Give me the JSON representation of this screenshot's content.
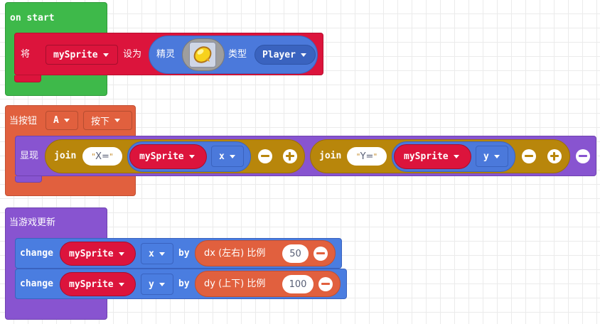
{
  "colors": {
    "loops_green": "#3eb94a",
    "sprites_red": "#dc143c",
    "controller_orange": "#e1603e",
    "game_purple": "#8854d0",
    "text_gold": "#b8860b",
    "math_blue": "#4a7de0",
    "sprite_blue": "#4b79db"
  },
  "on_start": {
    "hat_label": "on start",
    "set_label": "将",
    "variable": "mySprite",
    "to_label": "设为",
    "sprite_label": "精灵",
    "image_icon": "lemon-sprite-icon",
    "kind_label": "类型",
    "kind": "Player"
  },
  "button_event": {
    "label": "当按钮",
    "button": "A",
    "event": "按下",
    "show_label": "显现",
    "join1": {
      "label": "join",
      "text": "X=",
      "variable": "mySprite",
      "property": "x"
    },
    "join2": {
      "label": "join",
      "text": "Y=",
      "variable": "mySprite",
      "property": "y"
    }
  },
  "game_update": {
    "label": "当游戏更新",
    "change1": {
      "label": "change",
      "variable": "mySprite",
      "property": "x",
      "by_label": "by",
      "controller_label": "dx (左右) 比例",
      "value": "50"
    },
    "change2": {
      "label": "change",
      "variable": "mySprite",
      "property": "y",
      "by_label": "by",
      "controller_label": "dy (上下) 比例",
      "value": "100"
    }
  }
}
